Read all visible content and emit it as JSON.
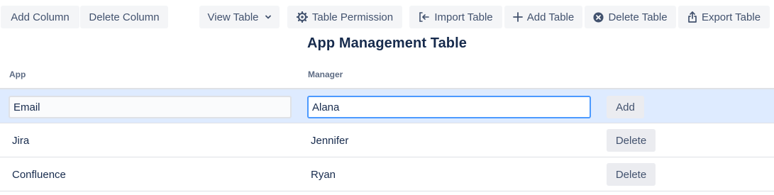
{
  "toolbar": {
    "add_column": "Add Column",
    "delete_column": "Delete Column",
    "view_table": "View Table",
    "table_permission": "Table Permission",
    "import_table": "Import Table",
    "add_table": "Add Table",
    "delete_table": "Delete Table",
    "export_table": "Export Table"
  },
  "table": {
    "title": "App Management Table",
    "columns": [
      "App",
      "Manager"
    ],
    "new_row": {
      "app_value": "Email",
      "manager_value": "Alana",
      "add_label": "Add"
    },
    "rows": [
      {
        "app": "Jira",
        "manager": "Jennifer",
        "action": "Delete"
      },
      {
        "app": "Confluence",
        "manager": "Ryan",
        "action": "Delete"
      }
    ]
  },
  "colors": {
    "button_bg": "#f4f5f7",
    "edit_row_bg": "#deebff",
    "focus_border": "#4c9aff",
    "text": "#172b4d"
  }
}
